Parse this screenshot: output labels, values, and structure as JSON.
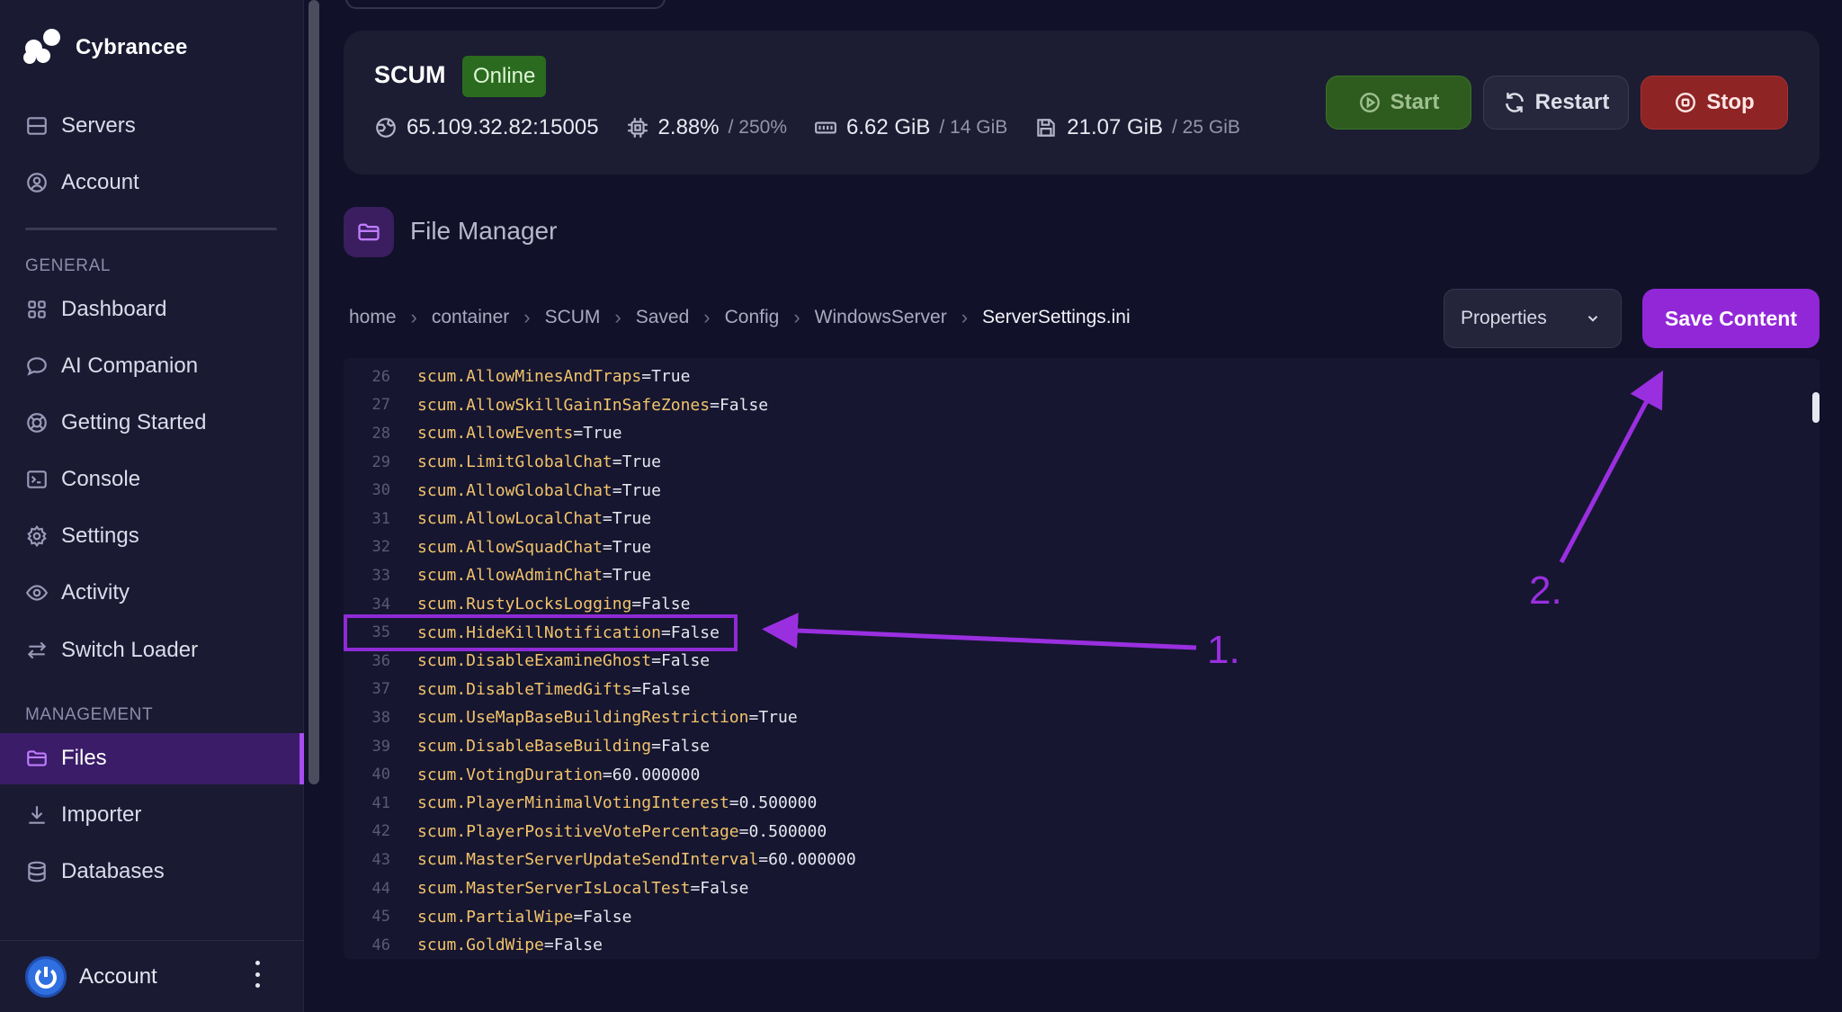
{
  "brand": {
    "name": "Cybrancee"
  },
  "nav_top": [
    {
      "label": "Servers",
      "icon": "server-icon"
    },
    {
      "label": "Account",
      "icon": "user-circle-icon"
    }
  ],
  "sections": {
    "general": "GENERAL",
    "management": "MANAGEMENT"
  },
  "nav_general": [
    {
      "label": "Dashboard",
      "icon": "grid-icon"
    },
    {
      "label": "AI Companion",
      "icon": "chat-icon"
    },
    {
      "label": "Getting Started",
      "icon": "lifebuoy-icon"
    },
    {
      "label": "Console",
      "icon": "terminal-icon"
    },
    {
      "label": "Settings",
      "icon": "gear-icon"
    },
    {
      "label": "Activity",
      "icon": "eye-icon"
    },
    {
      "label": "Switch Loader",
      "icon": "swap-icon"
    }
  ],
  "nav_management": [
    {
      "label": "Files",
      "icon": "folder-icon",
      "active": true
    },
    {
      "label": "Importer",
      "icon": "download-icon"
    },
    {
      "label": "Databases",
      "icon": "database-icon"
    }
  ],
  "footer": {
    "label": "Account"
  },
  "server": {
    "name": "SCUM",
    "status": "Online",
    "address": "65.109.32.82:15005",
    "cpu": "2.88%",
    "cpu_limit": "/ 250%",
    "memory": "6.62 GiB",
    "memory_limit": "/ 14 GiB",
    "disk": "21.07 GiB",
    "disk_limit": "/ 25 GiB"
  },
  "buttons": {
    "start": "Start",
    "restart": "Restart",
    "stop": "Stop"
  },
  "file_manager": {
    "title": "File Manager",
    "breadcrumb": [
      "home",
      "container",
      "SCUM",
      "Saved",
      "Config",
      "WindowsServer",
      "ServerSettings.ini"
    ],
    "mode_select": "Properties",
    "save_label": "Save Content"
  },
  "code_lines": [
    {
      "n": "26",
      "key": "scum.AllowMinesAndTraps",
      "value": "True"
    },
    {
      "n": "27",
      "key": "scum.AllowSkillGainInSafeZones",
      "value": "False"
    },
    {
      "n": "28",
      "key": "scum.AllowEvents",
      "value": "True"
    },
    {
      "n": "29",
      "key": "scum.LimitGlobalChat",
      "value": "True"
    },
    {
      "n": "30",
      "key": "scum.AllowGlobalChat",
      "value": "True"
    },
    {
      "n": "31",
      "key": "scum.AllowLocalChat",
      "value": "True"
    },
    {
      "n": "32",
      "key": "scum.AllowSquadChat",
      "value": "True"
    },
    {
      "n": "33",
      "key": "scum.AllowAdminChat",
      "value": "True"
    },
    {
      "n": "34",
      "key": "scum.RustyLocksLogging",
      "value": "False"
    },
    {
      "n": "35",
      "key": "scum.HideKillNotification",
      "value": "False"
    },
    {
      "n": "36",
      "key": "scum.DisableExamineGhost",
      "value": "False"
    },
    {
      "n": "37",
      "key": "scum.DisableTimedGifts",
      "value": "False"
    },
    {
      "n": "38",
      "key": "scum.UseMapBaseBuildingRestriction",
      "value": "True"
    },
    {
      "n": "39",
      "key": "scum.DisableBaseBuilding",
      "value": "False"
    },
    {
      "n": "40",
      "key": "scum.VotingDuration",
      "value": "60.000000"
    },
    {
      "n": "41",
      "key": "scum.PlayerMinimalVotingInterest",
      "value": "0.500000"
    },
    {
      "n": "42",
      "key": "scum.PlayerPositiveVotePercentage",
      "value": "0.500000"
    },
    {
      "n": "43",
      "key": "scum.MasterServerUpdateSendInterval",
      "value": "60.000000"
    },
    {
      "n": "44",
      "key": "scum.MasterServerIsLocalTest",
      "value": "False"
    },
    {
      "n": "45",
      "key": "scum.PartialWipe",
      "value": "False"
    },
    {
      "n": "46",
      "key": "scum.GoldWipe",
      "value": "False"
    }
  ],
  "annotations": {
    "step1": "1.",
    "step2": "2.",
    "color": "#9a2fe0"
  },
  "colors": {
    "accent": "#9227d8",
    "online": "#2a6b1f",
    "stop": "#8e2424",
    "start": "#2e5c1f"
  }
}
